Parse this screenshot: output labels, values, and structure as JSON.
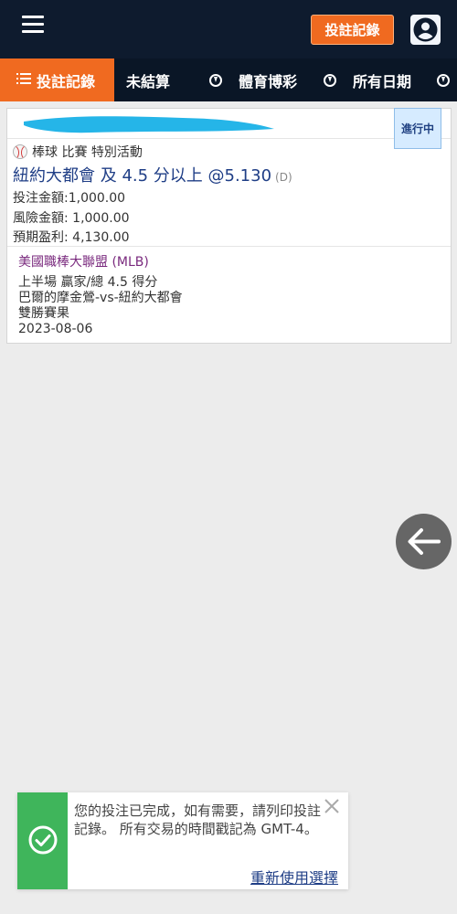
{
  "header": {
    "history_button": "投註記錄",
    "icons": {
      "menu": "hamburger-icon",
      "account": "user-icon"
    }
  },
  "tabs": [
    {
      "label": "投註記錄",
      "active": true,
      "icon": "list-icon"
    },
    {
      "label": "未結算",
      "active": false
    },
    {
      "label": "體育博彩",
      "active": false,
      "icon": "download-icon"
    },
    {
      "label": "所有日期",
      "active": false,
      "icon": "download-icon"
    }
  ],
  "bet": {
    "status": "進行中",
    "sport_line": "棒球 比賽 特別活動",
    "selection": "紐約大都會 及 4.5 分以上 @5.130",
    "odds_tag": "(D)",
    "stake": "投注金額:1,000.00",
    "risk": "風險金額: 1,000.00",
    "profit": "預期盈利: 4,130.00",
    "league": "美國職棒大聯盟 (MLB)",
    "market": "上半場 贏家/總 4.5 得分",
    "match": "巴爾的摩金鶯-vs-紐約大都會",
    "event": "雙勝賽果",
    "date": "2023-08-06"
  },
  "colors": {
    "accent": "#f06a20",
    "nav": "#0e1b2e",
    "selection": "#1f3e86",
    "league": "#7a2a7e",
    "success": "#3fb55b"
  },
  "toast": {
    "message": "您的投注已完成，如有需要，請列印投註記錄。 所有交易的時間戳記為 GMT-4。",
    "link": "重新使用選擇"
  }
}
